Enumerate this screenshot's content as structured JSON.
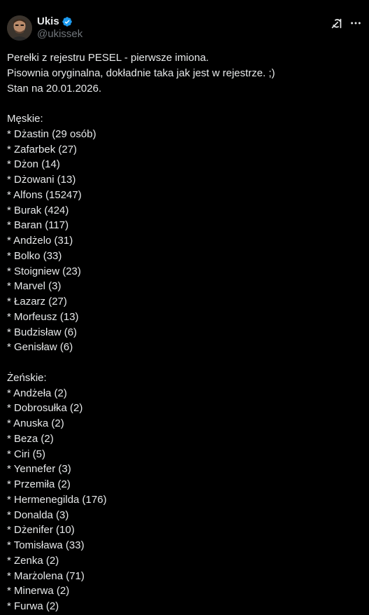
{
  "author": {
    "display_name": "Ukis",
    "handle": "@ukissek",
    "verified": true,
    "verified_color": "#1d9bf0"
  },
  "actions": {
    "grok_icon": "grok-icon",
    "more_icon": "more-icon"
  },
  "intro": [
    "Perełki z rejestru PESEL - pierwsze imiona.",
    "Pisownia oryginalna, dokładnie taka jak jest w rejestrze. ;)",
    "Stan na 20.01.2026."
  ],
  "male": {
    "heading": "Męskie:",
    "items": [
      "* Dżastin (29 osób)",
      "* Zafarbek (27)",
      "* Dżon (14)",
      "* Dżowani (13)",
      "* Alfons (15247)",
      "* Burak (424)",
      "* Baran (117)",
      "* Andżelo (31)",
      "* Bolko (33)",
      "* Stoigniew (23)",
      "* Marvel (3)",
      "* Łazarz (27)",
      "* Morfeusz (13)",
      "* Budzisław (6)",
      "* Genisław (6)"
    ]
  },
  "female": {
    "heading": "Żeńskie:",
    "items": [
      "* Andżeła (2)",
      "* Dobrosułka (2)",
      "* Anuska (2)",
      "* Beza (2)",
      "* Ciri (5)",
      "* Yennefer (3)",
      "* Przemiła (2)",
      "* Hermenegilda (176)",
      "* Donalda (3)",
      "* Dżenifer (10)",
      "* Tomisława (33)",
      "* Zenka (2)",
      "* Marżolena (71)",
      "* Minerwa (2)",
      "* Furwa (2)"
    ]
  },
  "colors": {
    "background": "#000000",
    "text": "#e7e9ea",
    "secondary_text": "#71767b"
  }
}
